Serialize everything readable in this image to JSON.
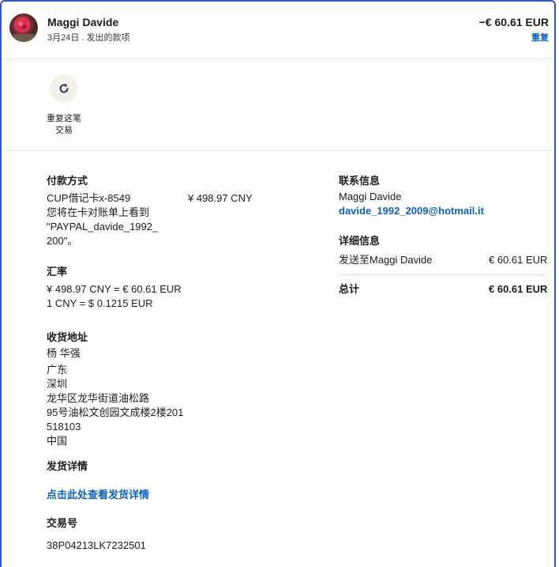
{
  "header": {
    "name": "Maggi Davide",
    "subline": "3月24日 . 发出的款项",
    "amount": "−€ 60.61 EUR",
    "repeat_link": "重复"
  },
  "action": {
    "label_line1": "重复这笔",
    "label_line2": "交易"
  },
  "payment": {
    "title": "付款方式",
    "card": "CUP借记卡x-8549",
    "amount": "¥ 498.97 CNY",
    "note_line1": "您将在卡对账单上看到",
    "note_line2": "\"PAYPAL_davide_1992_",
    "note_line3": "200\"。"
  },
  "exchange": {
    "title": "汇率",
    "line1": "¥ 498.97 CNY = € 60.61 EUR",
    "line2": "1 CNY = $ 0.1215 EUR"
  },
  "shipping_address": {
    "title": "收货地址",
    "name": "杨 华强",
    "province": "广东",
    "city": "深圳",
    "district": "龙华区龙华街道油松路",
    "street": "95号油松文创园文成楼2楼201",
    "postcode": "518103",
    "country": "中国"
  },
  "shipping_details": {
    "title": "发货详情",
    "link": "点击此处查看发货详情"
  },
  "transaction": {
    "title": "交易号",
    "id": "38P04213LK7232501"
  },
  "contact": {
    "title": "联系信息",
    "name": "Maggi Davide",
    "email": "davide_1992_2009@hotmail.it"
  },
  "details": {
    "title": "详细信息",
    "sent_to": "发送至Maggi Davide",
    "sent_amount": "€ 60.61 EUR",
    "total_label": "总计",
    "total_amount": "€ 60.61 EUR"
  },
  "colors": {
    "frame": "#2f57c4",
    "link": "#0a63b8"
  }
}
